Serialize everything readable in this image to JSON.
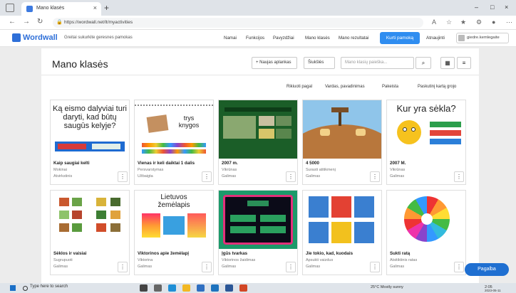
{
  "browser": {
    "tab_title": "Mano klasės",
    "url": "https://wordwall.net/lt/myactivities"
  },
  "header": {
    "logo": "Wordwall",
    "tagline": "Greitai sukurkite geresnes pamokas",
    "nav": [
      "Namai",
      "Funkcijos",
      "Pavyzdžiai",
      "Mano klasės",
      "Mano rezultatai"
    ],
    "create_button": "Kurti pamoką",
    "upgrade": "Atnaujinti",
    "user_name": "giedre.kemlegaite"
  },
  "toolbar": {
    "page_title": "Mano klasės",
    "new_folder": "+ Naujas aplankas",
    "recycle": "Šiukšlės",
    "search_placeholder": "Mano klasių paieška...",
    "sort_labels": [
      "Rikiuoti pagal",
      "Vardas, pavadinimas",
      "Pakeista",
      "Paskutinį kartą grojo"
    ]
  },
  "cards": [
    {
      "title": "Kaip saugiai kelti",
      "type": "Mokinai",
      "meta": "Atvirkstinis",
      "thumb_text": "Ką eismo dalyviai turi daryti, kad būtų saugūs kelyje?",
      "thumb_style": "text"
    },
    {
      "title": "Vienas ir keli daiktai 1 dalis",
      "type": "Persvarstymas",
      "meta": "Užbaigta",
      "thumb_text": "trys knygos",
      "thumb_style": "books"
    },
    {
      "title": "2007 m.",
      "type": "Vikrūnas",
      "meta": "Galimas",
      "thumb_text": "",
      "thumb_style": "green"
    },
    {
      "title": "4 5000",
      "type": "Surasti atitikmenį",
      "meta": "Galimas",
      "thumb_text": "",
      "thumb_style": "field"
    },
    {
      "title": "2007 M.",
      "type": "Vikrūnas",
      "meta": "Galimas",
      "thumb_text": "Kur yra sėkla?",
      "thumb_style": "seed"
    },
    {
      "title": "Sėklos ir vaisiai",
      "type": "Sugrupuoti",
      "meta": "Galimas",
      "thumb_text": "",
      "thumb_style": "grid"
    },
    {
      "title": "Viktorinos apie žemėlapį",
      "type": "Viktorina",
      "meta": "Galimas",
      "thumb_text": "Lietuvos žemėlapis",
      "thumb_style": "map"
    },
    {
      "title": "Įgūs tvarkas",
      "type": "Viktorinos žaidimas",
      "meta": "Galimas",
      "thumb_text": "",
      "thumb_style": "tv"
    },
    {
      "title": "Jie tokio, kad, kuodais",
      "type": "Apsukti vaizdus",
      "meta": "Galimas",
      "thumb_text": "",
      "thumb_style": "fruits"
    },
    {
      "title": "Sukti ratą",
      "type": "Atsitiktinis ratas",
      "meta": "Galimas",
      "thumb_text": "",
      "thumb_style": "wheel"
    }
  ],
  "help_button": "Pagalba",
  "taskbar": {
    "search": "Type here to search",
    "weather": "25°C Mostly sunny",
    "time": "2:05",
    "date": "2023-05-11"
  }
}
